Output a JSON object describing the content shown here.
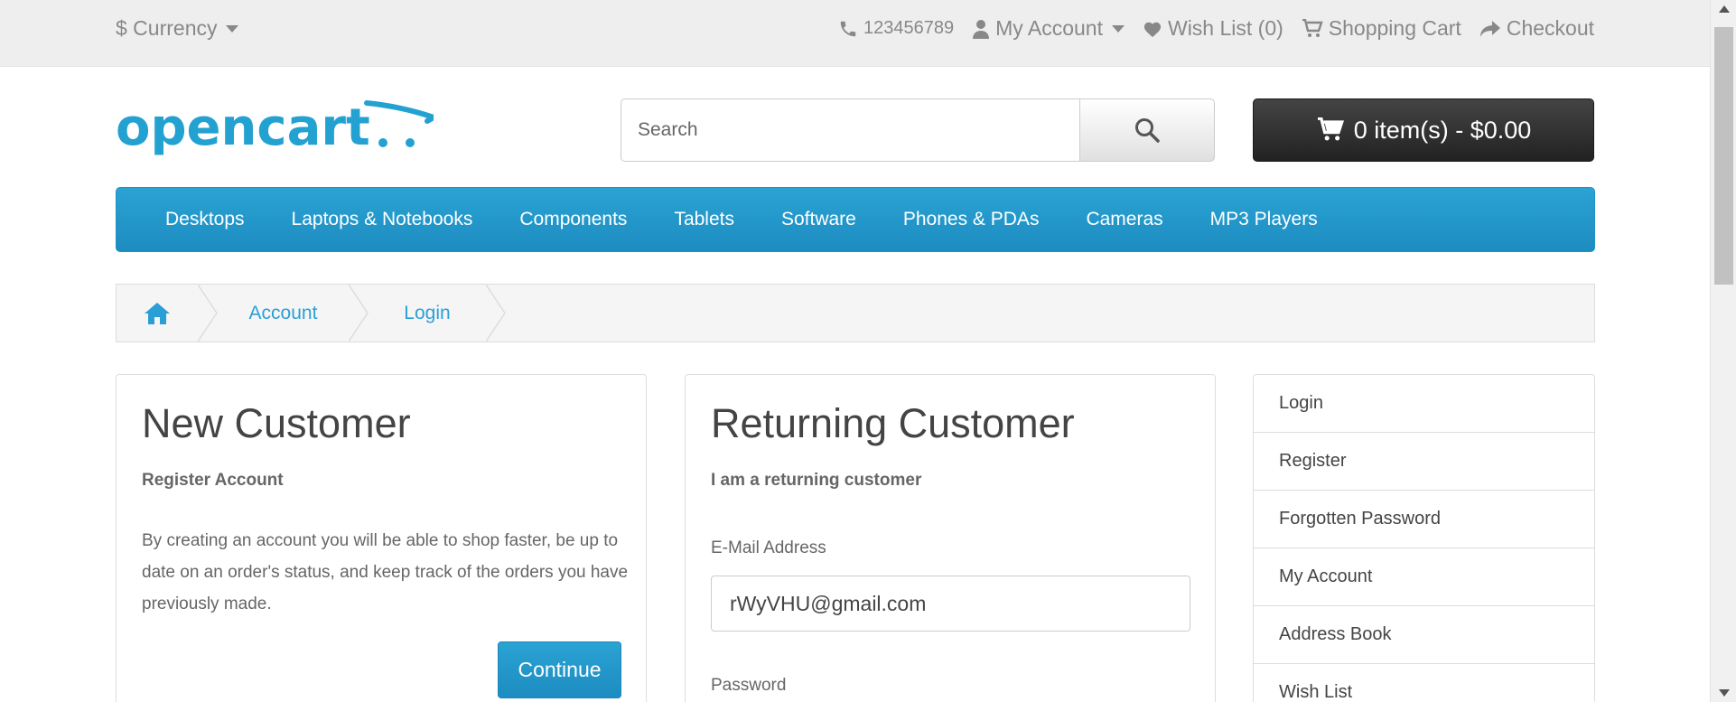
{
  "topbar": {
    "currency_label": "$ Currency",
    "phone": "123456789",
    "my_account": "My Account",
    "wish_list": "Wish List (0)",
    "shopping_cart": "Shopping Cart",
    "checkout": "Checkout"
  },
  "header": {
    "logo_text": "opencart",
    "search_placeholder": "Search",
    "cart_label": "0 item(s) - $0.00"
  },
  "menu": {
    "items": [
      "Desktops",
      "Laptops & Notebooks",
      "Components",
      "Tablets",
      "Software",
      "Phones & PDAs",
      "Cameras",
      "MP3 Players"
    ]
  },
  "breadcrumb": {
    "items": [
      "Account",
      "Login"
    ]
  },
  "new_customer": {
    "title": "New Customer",
    "subtitle": "Register Account",
    "description": "By creating an account you will be able to shop faster, be up to date on an order's status, and keep track of the orders you have previously made.",
    "continue_label": "Continue"
  },
  "returning_customer": {
    "title": "Returning Customer",
    "subtitle": "I am a returning customer",
    "email_label": "E-Mail Address",
    "email_value": "rWyVHU@gmail.com",
    "password_label": "Password"
  },
  "sidebar": {
    "items": [
      "Login",
      "Register",
      "Forgotten Password",
      "My Account",
      "Address Book",
      "Wish List"
    ]
  },
  "colors": {
    "accent": "#229ac8",
    "topbar_bg": "#eeeeee",
    "cart_bg": "#303030"
  }
}
